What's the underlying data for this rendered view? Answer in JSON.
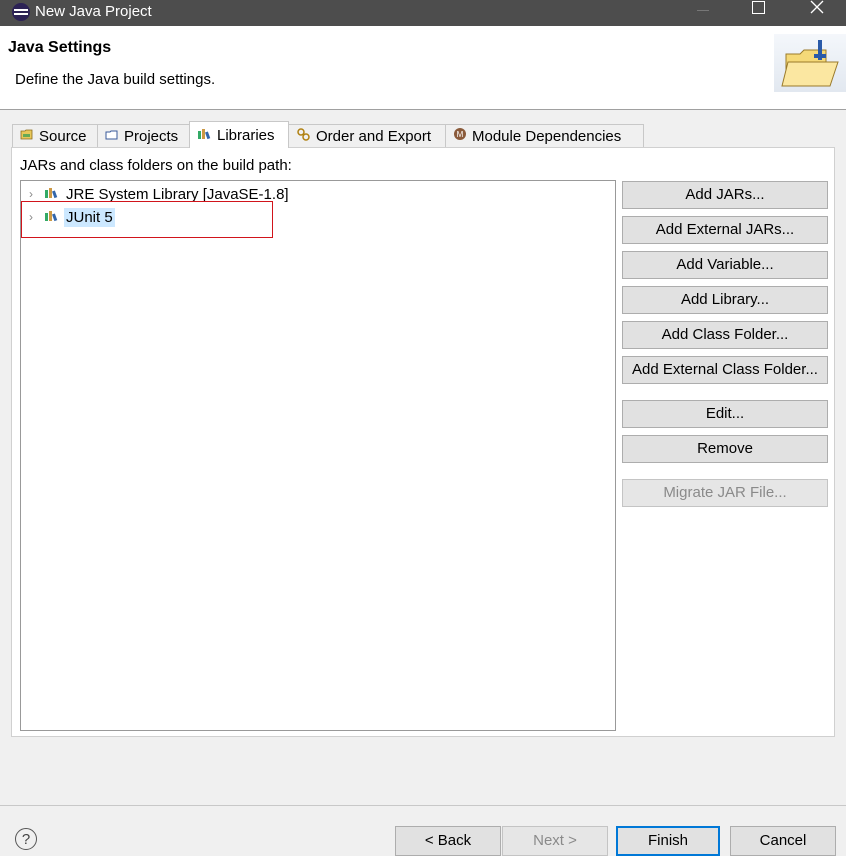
{
  "window": {
    "title": "New Java Project"
  },
  "header": {
    "title": "Java Settings",
    "description": "Define the Java build settings."
  },
  "tabs": [
    {
      "label": "Source",
      "icon": "source-folder-icon",
      "active": false
    },
    {
      "label": "Projects",
      "icon": "projects-icon",
      "active": false
    },
    {
      "label": "Libraries",
      "icon": "library-icon",
      "active": true
    },
    {
      "label": "Order and Export",
      "icon": "order-export-icon",
      "active": false
    },
    {
      "label": "Module Dependencies",
      "icon": "module-icon",
      "active": false
    }
  ],
  "libraries": {
    "section_label": "JARs and class folders on the build path:",
    "items": [
      {
        "label": "JRE System Library [JavaSE-1.8]",
        "icon": "library-icon",
        "selected": false
      },
      {
        "label": "JUnit 5",
        "icon": "library-icon",
        "selected": true
      }
    ]
  },
  "buttons": {
    "add_jars": "Add JARs...",
    "add_external_jars": "Add External JARs...",
    "add_variable": "Add Variable...",
    "add_library": "Add Library...",
    "add_class_folder": "Add Class Folder...",
    "add_external_class_folder": "Add External Class Folder...",
    "edit": "Edit...",
    "remove": "Remove",
    "migrate_jar": "Migrate JAR File..."
  },
  "footer": {
    "help": "?",
    "back": "< Back",
    "next": "Next >",
    "finish": "Finish",
    "cancel": "Cancel"
  },
  "colors": {
    "selection": "#cce8ff",
    "highlight_box": "#d1141b",
    "default_button_border": "#0078d7"
  }
}
